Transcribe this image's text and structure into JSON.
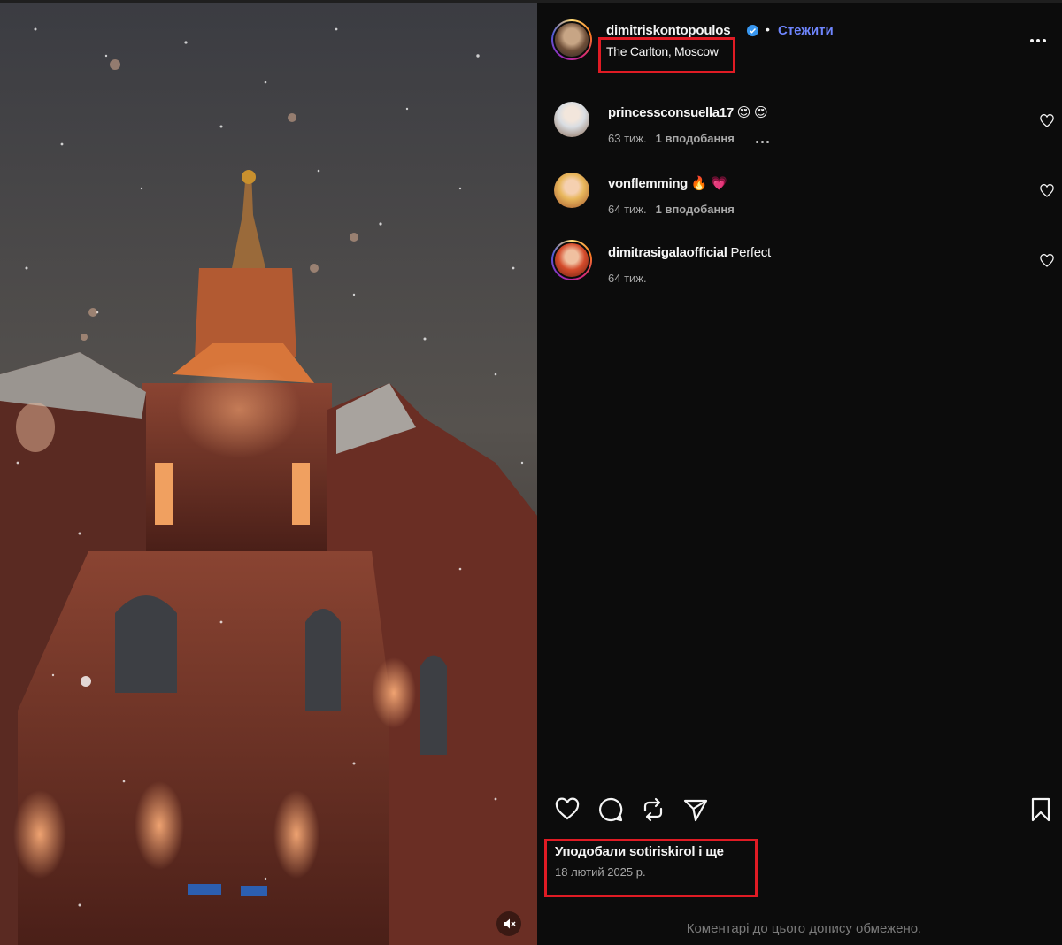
{
  "post": {
    "author": "dimitriskontopoulos",
    "verified": true,
    "separator": "•",
    "follow_label": "Стежити",
    "location": "The Carlton, Moscow",
    "more_icon": "more-horizontal-icon"
  },
  "comments": [
    {
      "user": "princessconsuella17",
      "text": "😍 😍",
      "age": "63 тиж.",
      "likes": "1 вподобання",
      "has_more": true,
      "avatar_colors": [
        "#d9dde2",
        "#8a6a54"
      ]
    },
    {
      "user": "vonflemming",
      "text": "🔥 💗",
      "age": "64 тиж.",
      "likes": "1 вподобання",
      "has_more": false,
      "avatar_colors": [
        "#e8b75c",
        "#a5552c"
      ]
    },
    {
      "user": "dimitrasigalaofficial",
      "text": "Perfect",
      "age": "64 тиж.",
      "likes": "",
      "has_more": false,
      "avatar_colors": [
        "#d44b2b",
        "#f0a070"
      ]
    }
  ],
  "actions": {
    "like": "heart-icon",
    "comment": "comment-icon",
    "repost": "repost-icon",
    "share": "send-icon",
    "save": "bookmark-icon"
  },
  "likes_summary": {
    "prefix": "Уподобали",
    "user": "sotiriskirol",
    "suffix": "і ще"
  },
  "post_date": "18 лютий 2025 р.",
  "comments_limited": "Коментарі до цього допису обмежено.",
  "media": {
    "mute_icon": "speaker-muted-icon"
  },
  "colors": {
    "background": "#0c0c0c",
    "accent_link": "#6f86ff",
    "highlight_box": "#e01b24",
    "muted_text": "#a8a8a8",
    "verified_badge": "#3897f0"
  }
}
